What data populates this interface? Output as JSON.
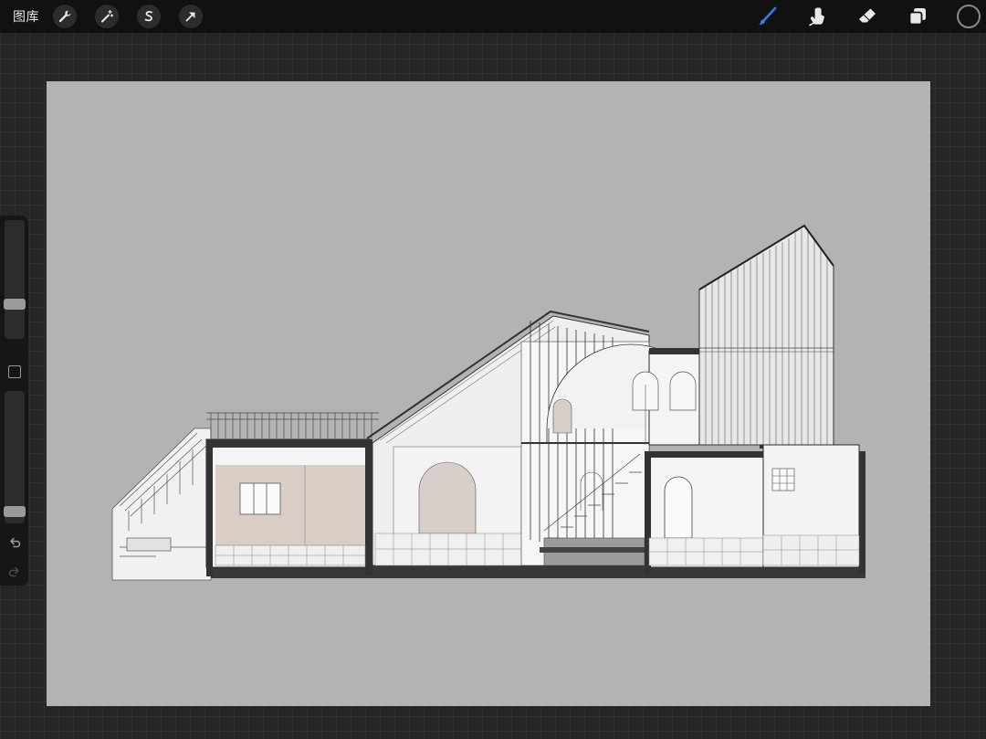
{
  "topbar": {
    "gallery_label": "图库",
    "left_tools": [
      {
        "name": "actions",
        "icon": "wrench-icon"
      },
      {
        "name": "adjustments",
        "icon": "magic-wand-icon"
      },
      {
        "name": "selection",
        "icon": "selection-s-icon"
      },
      {
        "name": "transform",
        "icon": "arrow-cursor-icon"
      }
    ],
    "right_tools": [
      {
        "name": "brush",
        "icon": "brush-icon",
        "active": true
      },
      {
        "name": "smudge",
        "icon": "smudge-finger-icon",
        "active": false
      },
      {
        "name": "eraser",
        "icon": "eraser-icon",
        "active": false
      },
      {
        "name": "layers",
        "icon": "layers-icon",
        "active": false
      }
    ],
    "active_color": "#111111"
  },
  "sidebar": {
    "brush_size_level": 0.27,
    "opacity_level": 0.05,
    "modify_icon": "square-icon",
    "undo_icon": "undo-icon",
    "redo_icon": "redo-icon"
  },
  "colors": {
    "accent": "#2f7cf6",
    "canvas": "#b3b3b3",
    "background": "#262626"
  }
}
